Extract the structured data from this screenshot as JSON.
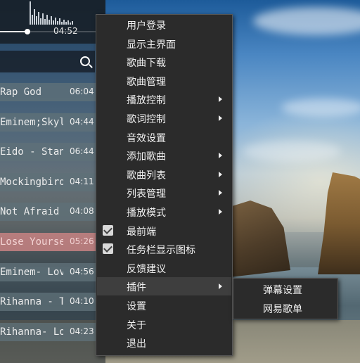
{
  "player": {
    "current_time": "04:52",
    "progress_fraction": 0.26,
    "songs": [
      {
        "title": "Rap God",
        "duration": "06:04",
        "active": false
      },
      {
        "title": "Eminem;Skyla",
        "duration": "04:44",
        "active": false
      },
      {
        "title": "Eido - Stan",
        "duration": "06:44",
        "active": false
      },
      {
        "title": "Mockingbird",
        "duration": "04:11",
        "active": false
      },
      {
        "title": "Not Afraid",
        "duration": "04:08",
        "active": false
      },
      {
        "title": "Lose Yourse",
        "duration": "05:26",
        "active": true
      },
      {
        "title": "Eminem- Lov",
        "duration": "04:56",
        "active": false
      },
      {
        "title": "Rihanna - The",
        "duration": "04:10",
        "active": false
      },
      {
        "title": "Rihanna- Lov",
        "duration": "04:23",
        "active": false
      }
    ]
  },
  "menu": {
    "items": [
      {
        "label": "用户登录",
        "submenu": false,
        "checked": false
      },
      {
        "label": "显示主界面",
        "submenu": false,
        "checked": false
      },
      {
        "label": "歌曲下载",
        "submenu": false,
        "checked": false
      },
      {
        "label": "歌曲管理",
        "submenu": false,
        "checked": false
      },
      {
        "label": "播放控制",
        "submenu": true,
        "checked": false
      },
      {
        "label": "歌词控制",
        "submenu": true,
        "checked": false
      },
      {
        "label": "音效设置",
        "submenu": false,
        "checked": false
      },
      {
        "label": "添加歌曲",
        "submenu": true,
        "checked": false
      },
      {
        "label": "歌曲列表",
        "submenu": true,
        "checked": false
      },
      {
        "label": "列表管理",
        "submenu": true,
        "checked": false
      },
      {
        "label": "播放模式",
        "submenu": true,
        "checked": false
      },
      {
        "label": "最前端",
        "submenu": false,
        "checked": true
      },
      {
        "label": "任务栏显示图标",
        "submenu": false,
        "checked": true
      },
      {
        "label": "反馈建议",
        "submenu": false,
        "checked": false
      },
      {
        "label": "插件",
        "submenu": true,
        "checked": false,
        "highlighted": true
      },
      {
        "label": "设置",
        "submenu": false,
        "checked": false
      },
      {
        "label": "关于",
        "submenu": false,
        "checked": false
      },
      {
        "label": "退出",
        "submenu": false,
        "checked": false
      }
    ],
    "plugin_submenu": [
      {
        "label": "弹幕设置"
      },
      {
        "label": "网易歌单"
      }
    ]
  },
  "icons": {
    "search": "search-icon",
    "submenu_arrow": "chevron-right-icon",
    "checkbox": "checkbox-checked-icon"
  }
}
